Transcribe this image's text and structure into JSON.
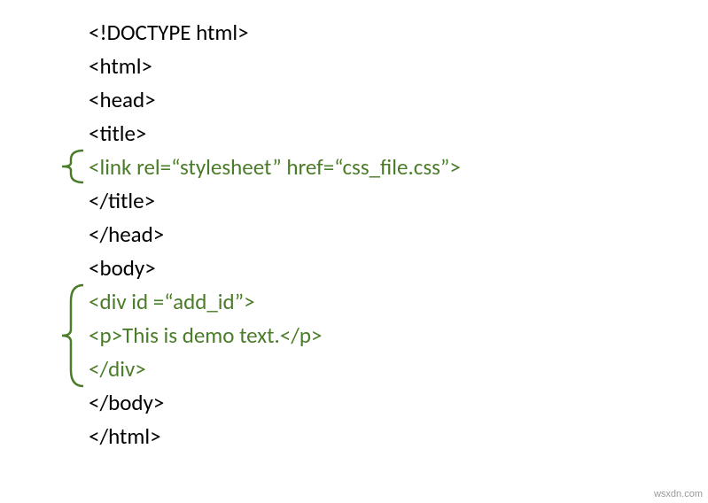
{
  "code": {
    "line1": "<!DOCTYPE html>",
    "line2": "<html>",
    "line3": "<head>",
    "line4": "<title>",
    "line5": "<link rel=“stylesheet” href=“css_file.css”>",
    "line6": "</title>",
    "line7": "</head>",
    "line8": "<body>",
    "line9": "<div id =“add_id”>",
    "line10": "<p>This is demo text.</p>",
    "line11": "</div>",
    "line12": "</body>",
    "line13": "</html>"
  },
  "colors": {
    "highlight": "#4a7c2a",
    "text": "#000000",
    "bracket": "#4a7c2a"
  },
  "watermark": "wsxdn.com"
}
